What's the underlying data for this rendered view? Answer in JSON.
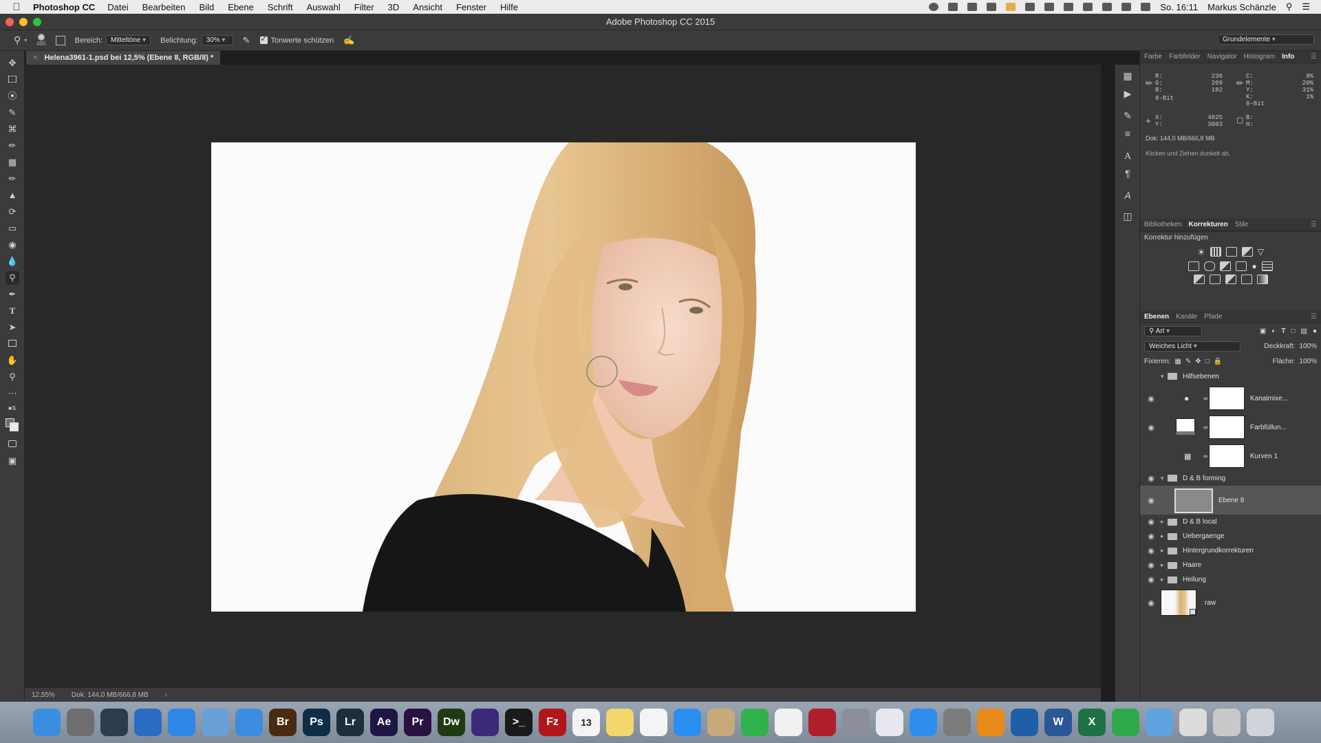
{
  "menubar": {
    "app_name": "Photoshop CC",
    "items": [
      "Datei",
      "Bearbeiten",
      "Bild",
      "Ebene",
      "Schrift",
      "Auswahl",
      "Filter",
      "3D",
      "Ansicht",
      "Fenster",
      "Hilfe"
    ],
    "clock": "So. 16:11",
    "user": "Markus Schänzle"
  },
  "window": {
    "title": "Adobe Photoshop CC 2015"
  },
  "options": {
    "brush_size": "485",
    "range_label": "Bereich:",
    "range_value": "Mitteltöne",
    "exposure_label": "Belichtung:",
    "exposure_value": "30%",
    "protect_tones_label": "Tonwerte schützen",
    "workspace": "Grundelemente"
  },
  "document": {
    "tab_label": "Helena3961-1.psd bei 12,5% (Ebene 8, RGB/8) *",
    "zoom": "12,55%",
    "doc_size": "Dok: 144,0 MB/666,8 MB"
  },
  "info_panel": {
    "tabs": [
      "Farbe",
      "Farbfelder",
      "Navigator",
      "Histogram",
      "Info"
    ],
    "active_tab": "Info",
    "rgb": {
      "r_label": "R:",
      "g_label": "G:",
      "b_label": "B:",
      "r": "236",
      "g": "209",
      "b": "182",
      "bit": "8-Bit"
    },
    "cmyk": {
      "c_label": "C:",
      "m_label": "M:",
      "y_label": "Y:",
      "k_label": "K:",
      "c": "8%",
      "m": "20%",
      "y": "31%",
      "k": "1%",
      "bit": "8-Bit"
    },
    "xy": {
      "x_label": "X:",
      "y_label": "Y:",
      "x": "4825",
      "y": "3003"
    },
    "bh": {
      "b_label": "B:",
      "h_label": "H:"
    },
    "doc_size": "Dok: 144,0 MB/666,8 MB",
    "hint": "Klicken und Ziehen dunkelt ab."
  },
  "corrections_panel": {
    "tabs": [
      "Bibliotheken",
      "Korrekturen",
      "Stile"
    ],
    "active_tab": "Korrekturen",
    "title": "Korrektur hinzufügen"
  },
  "layers_panel": {
    "tabs": [
      "Ebenen",
      "Kanäle",
      "Pfade"
    ],
    "active_tab": "Ebenen",
    "filter_value": "Art",
    "blend_mode": "Weiches Licht",
    "opacity_label": "Deckkraft:",
    "opacity": "100%",
    "lock_label": "Fixieren:",
    "fill_label": "Fläche:",
    "fill": "100%",
    "layers": [
      {
        "name": "Hilfsebenen"
      },
      {
        "name": "Kanalmixe..."
      },
      {
        "name": "Farbfüllun..."
      },
      {
        "name": "Kurven 1"
      },
      {
        "name": "D & B forming"
      },
      {
        "name": "Ebene 8"
      },
      {
        "name": "D & B local"
      },
      {
        "name": "Uebergaenge"
      },
      {
        "name": "Hintergrundkorrekturen"
      },
      {
        "name": "Haare"
      },
      {
        "name": "Heilung"
      },
      {
        "name": "raw"
      }
    ]
  },
  "dock": {
    "apps": [
      {
        "name": "Finder",
        "label": "",
        "color": "#3b8de0"
      },
      {
        "name": "Launchpad",
        "label": "",
        "color": "#6e6e6e"
      },
      {
        "name": "Mission Control",
        "label": "",
        "color": "#2d3b4f"
      },
      {
        "name": "Xcode",
        "label": "",
        "color": "#2a6cc4"
      },
      {
        "name": "Safari",
        "label": "",
        "color": "#2f86e8"
      },
      {
        "name": "Preview",
        "label": "",
        "color": "#6aa0d8"
      },
      {
        "name": "1Password",
        "label": "",
        "color": "#3b8de0"
      },
      {
        "name": "Bridge",
        "label": "Br",
        "color": "#4a2b10"
      },
      {
        "name": "Photoshop",
        "label": "Ps",
        "color": "#0e2d47"
      },
      {
        "name": "Lightroom",
        "label": "Lr",
        "color": "#1d2e3d"
      },
      {
        "name": "After Effects",
        "label": "Ae",
        "color": "#1f1743"
      },
      {
        "name": "Premiere",
        "label": "Pr",
        "color": "#2a1140"
      },
      {
        "name": "Dreamweaver",
        "label": "Dw",
        "color": "#213a14"
      },
      {
        "name": "iMovie",
        "label": "",
        "color": "#3b2a7a"
      },
      {
        "name": "Terminal",
        "label": ">_",
        "color": "#1a1a1a"
      },
      {
        "name": "FileZilla",
        "label": "Fz",
        "color": "#b2161a"
      },
      {
        "name": "Calendar",
        "label": "13",
        "color": "#f4f4f4"
      },
      {
        "name": "Notes",
        "label": "",
        "color": "#f3d76a"
      },
      {
        "name": "Reminders",
        "label": "",
        "color": "#f4f4f4"
      },
      {
        "name": "Messages",
        "label": "",
        "color": "#2b8ff0"
      },
      {
        "name": "Contacts",
        "label": "",
        "color": "#c8a97a"
      },
      {
        "name": "FaceTime",
        "label": "",
        "color": "#2fb24c"
      },
      {
        "name": "Photos",
        "label": "",
        "color": "#f1f1f1"
      },
      {
        "name": "Photo Booth",
        "label": "",
        "color": "#b01e2a"
      },
      {
        "name": "Image Capture",
        "label": "",
        "color": "#8a8f99"
      },
      {
        "name": "iTunes",
        "label": "",
        "color": "#e7e7ef"
      },
      {
        "name": "App Store",
        "label": "",
        "color": "#2e8ef0"
      },
      {
        "name": "System Preferences",
        "label": "",
        "color": "#7b7b7b"
      },
      {
        "name": "VLC",
        "label": "",
        "color": "#e88a17"
      },
      {
        "name": "Network Utility",
        "label": "",
        "color": "#1f5fa8"
      },
      {
        "name": "Word",
        "label": "W",
        "color": "#2b5796"
      },
      {
        "name": "Excel",
        "label": "X",
        "color": "#1e7145"
      },
      {
        "name": "Evernote",
        "label": "",
        "color": "#2fa84a"
      },
      {
        "name": "Applications Folder",
        "label": "",
        "color": "#5fa3e0"
      },
      {
        "name": "Brushes",
        "label": "",
        "color": "#dcdcdc"
      },
      {
        "name": "Documents",
        "label": "",
        "color": "#c9c9c9"
      },
      {
        "name": "Trash",
        "label": "",
        "color": "#d0d4da"
      }
    ]
  }
}
